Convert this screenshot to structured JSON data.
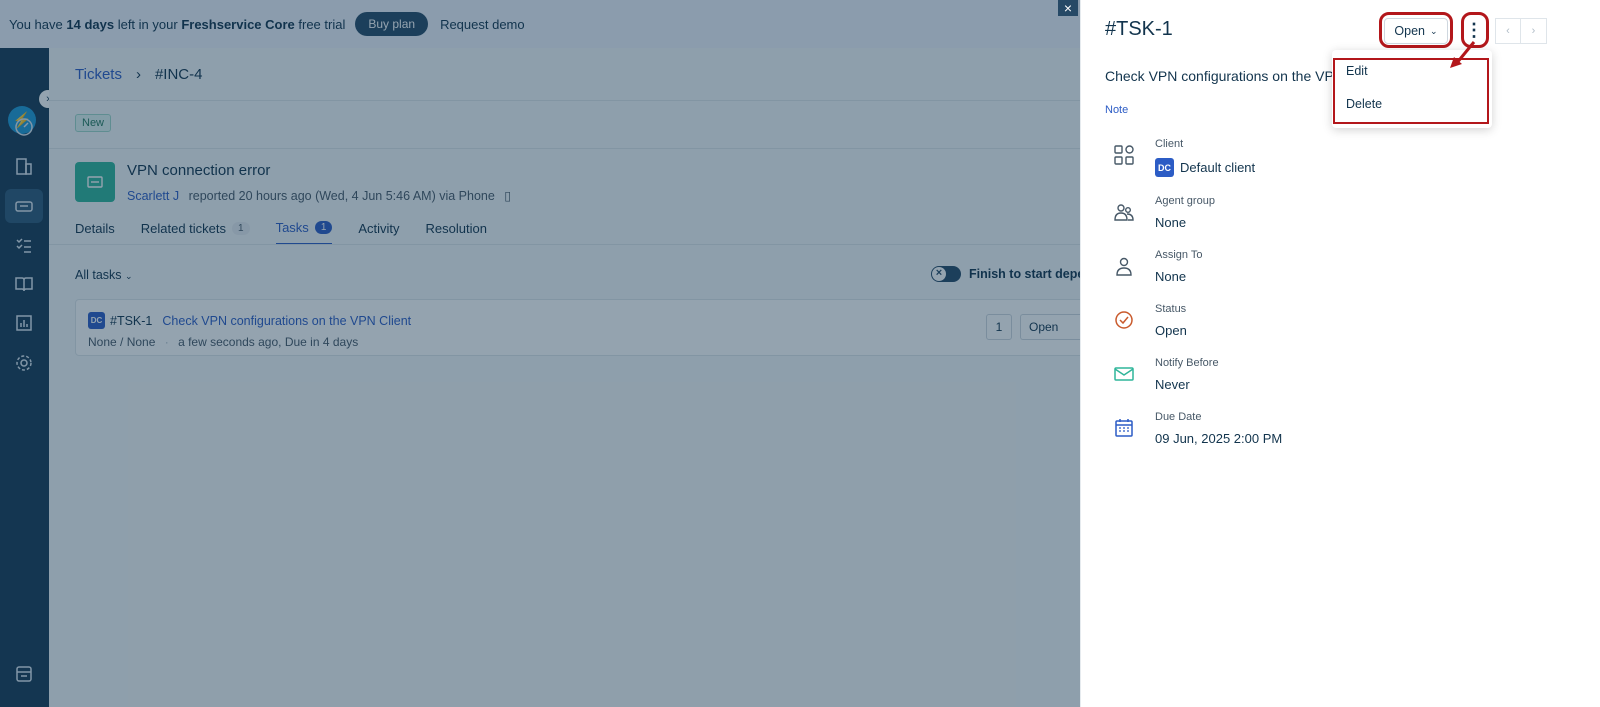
{
  "trial_bar": {
    "prefix": "You have",
    "days": "14 days",
    "middle": "left in your",
    "product": "Freshservice Core",
    "suffix": "free trial",
    "buy_plan": "Buy plan",
    "request_demo": "Request demo"
  },
  "breadcrumb": {
    "tickets": "Tickets",
    "separator": "›",
    "current": "#INC-4"
  },
  "ticket": {
    "status_badge": "New",
    "title": "VPN connection error",
    "requester": "Scarlett J",
    "meta": "reported 20 hours ago (Wed, 4 Jun 5:46 AM) via Phone"
  },
  "tabs": [
    {
      "label": "Details"
    },
    {
      "label": "Related tickets",
      "count": "1"
    },
    {
      "label": "Tasks",
      "count": "1"
    },
    {
      "label": "Activity"
    },
    {
      "label": "Resolution"
    }
  ],
  "tasks": {
    "filter": "All tasks",
    "toggle_label": "Finish to start depen",
    "card": {
      "badge": "DC",
      "id": "#TSK-1",
      "title": "Check VPN configurations on the VPN Client",
      "assignee": "None / None",
      "time": "a few seconds ago, Due in 4 days",
      "number": "1",
      "status": "Open"
    }
  },
  "close_label": "×",
  "panel": {
    "title": "#TSK-1",
    "status": "Open",
    "more_label": "⋮",
    "subtitle": "Check VPN configurations on the VP",
    "note": "Note",
    "fields": {
      "client": {
        "label": "Client",
        "badge": "DC",
        "value": "Default client"
      },
      "agent_group": {
        "label": "Agent group",
        "value": "None"
      },
      "assign_to": {
        "label": "Assign To",
        "value": "None"
      },
      "status": {
        "label": "Status",
        "value": "Open"
      },
      "notify_before": {
        "label": "Notify Before",
        "value": "Never"
      },
      "due_date": {
        "label": "Due Date",
        "value": "09 Jun, 2025 2:00 PM"
      }
    },
    "menu": {
      "edit": "Edit",
      "delete": "Delete"
    }
  },
  "colors": {
    "accent": "#2c5cc5",
    "sidebar": "#163a55",
    "highlight": "#b3171b",
    "status_icon": "#c95a2c",
    "notify_icon": "#2fb59a"
  }
}
